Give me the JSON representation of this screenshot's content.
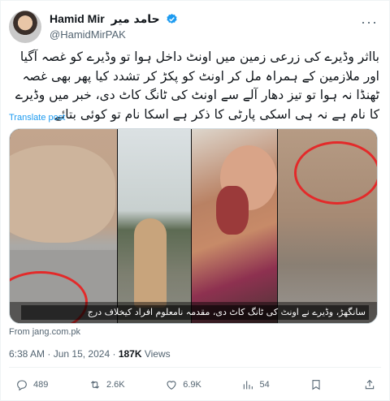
{
  "author": {
    "name": "Hamid Mir",
    "name_urdu": "حامد میر",
    "handle": "@HamidMirPAK",
    "verified": true
  },
  "post": {
    "text": "بااثر وڈیرے کی زرعی زمین میں اونٹ داخل ہوا تو وڈیرے کو غصہ آگیا اور ملازمین کے ہمراہ مل کر اونٹ کو پکڑ کر تشدد کیا پھر بھی غصہ ٹھنڈا نہ ہوا تو تیز دھار آلے سے اونٹ کی ٹانگ کاٹ دی، خبر میں وڈیرے کا نام ہے نہ ہی اسکی پارٹی کا ذکر ہے اسکا نام تو کوئی بتائے",
    "translate_label": "Translate post",
    "media_caption": "سانگھڑ، وڈیرے نے اونٹ کی ٹانگ کاٹ دی، مقدمہ نامعلوم افراد کیخلاف درج",
    "source": "From jang.com.pk",
    "time": "6:38 AM",
    "date": "Jun 15, 2024",
    "views_count": "187K",
    "views_label": "Views"
  },
  "actions": {
    "replies": "489",
    "reposts": "2.6K",
    "likes": "6.9K",
    "bookmarks": "54"
  },
  "colors": {
    "accent": "#1d9bf0",
    "text": "#0f1419",
    "secondary": "#536471",
    "highlight_circle": "#e32a2a"
  }
}
